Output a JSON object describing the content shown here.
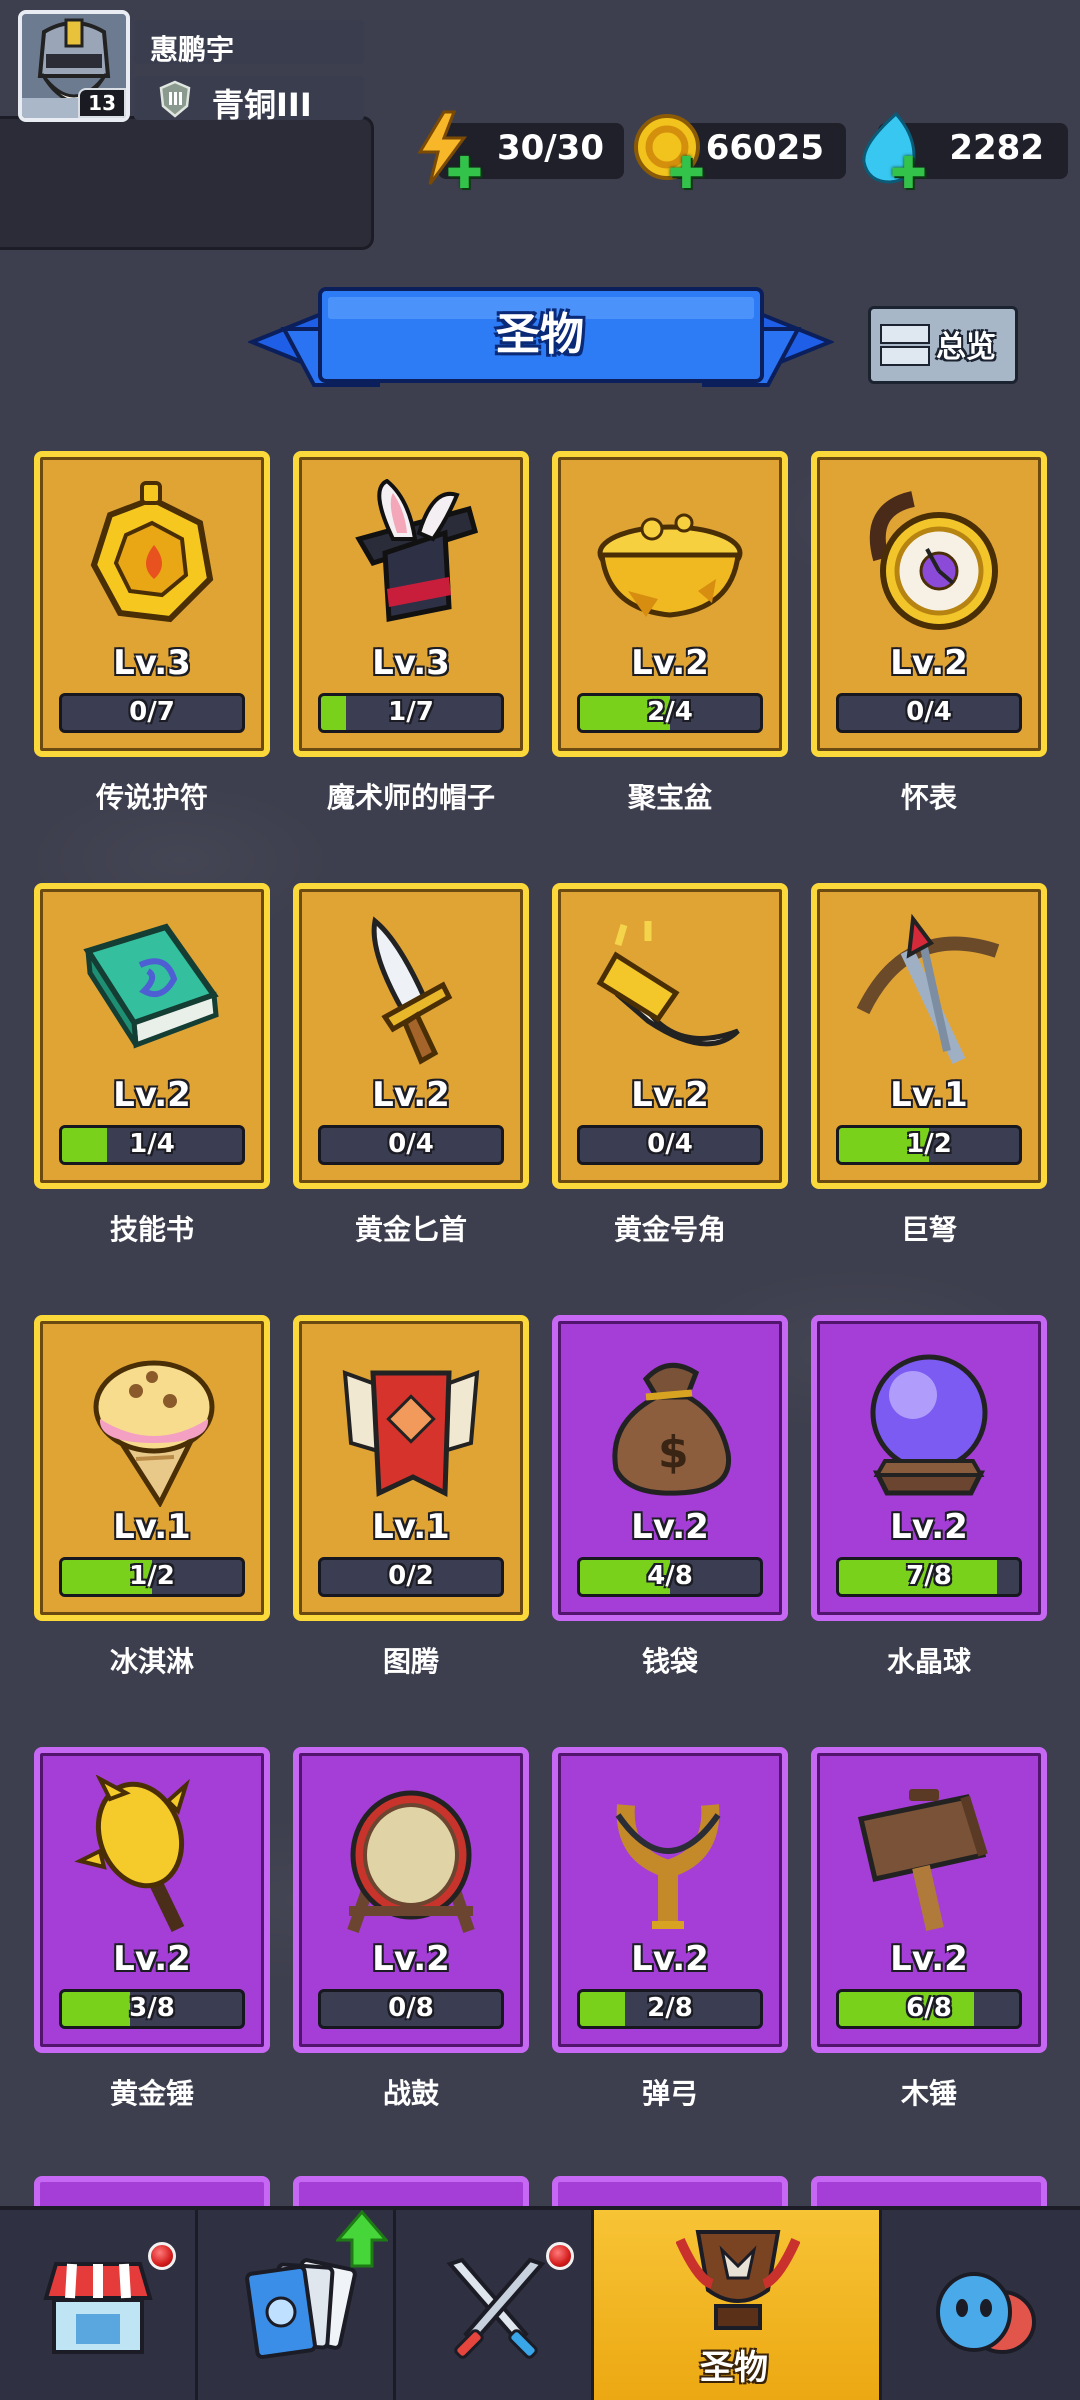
{
  "player": {
    "name": "惠鹏宇",
    "level": "13",
    "rank": "青铜III"
  },
  "currencies": {
    "energy": {
      "icon": "lightning-icon",
      "value": "30/30",
      "color": "#f7b728"
    },
    "gold": {
      "icon": "gold-coin-icon",
      "value": "66025",
      "color": "#f2c21d"
    },
    "gems": {
      "icon": "water-drop-icon",
      "value": "2282",
      "color": "#38c7f0"
    }
  },
  "title": "圣物",
  "overview_label": "总览",
  "items": [
    {
      "name": "传说护符",
      "level": "Lv.3",
      "progress": "0/7",
      "fill": 0,
      "rarity": "gold",
      "icon": "amulet-icon"
    },
    {
      "name": "魔术师的帽子",
      "level": "Lv.3",
      "progress": "1/7",
      "fill": 0.14,
      "rarity": "gold",
      "icon": "magician-hat-icon"
    },
    {
      "name": "聚宝盆",
      "level": "Lv.2",
      "progress": "2/4",
      "fill": 0.5,
      "rarity": "gold",
      "icon": "treasure-bowl-icon"
    },
    {
      "name": "怀表",
      "level": "Lv.2",
      "progress": "0/4",
      "fill": 0,
      "rarity": "gold",
      "icon": "pocket-watch-icon"
    },
    {
      "name": "技能书",
      "level": "Lv.2",
      "progress": "1/4",
      "fill": 0.25,
      "rarity": "gold",
      "icon": "skill-book-icon"
    },
    {
      "name": "黄金匕首",
      "level": "Lv.2",
      "progress": "0/4",
      "fill": 0,
      "rarity": "gold",
      "icon": "dagger-icon"
    },
    {
      "name": "黄金号角",
      "level": "Lv.2",
      "progress": "0/4",
      "fill": 0,
      "rarity": "gold",
      "icon": "horn-icon"
    },
    {
      "name": "巨弩",
      "level": "Lv.1",
      "progress": "1/2",
      "fill": 0.5,
      "rarity": "gold",
      "icon": "crossbow-icon"
    },
    {
      "name": "冰淇淋",
      "level": "Lv.1",
      "progress": "1/2",
      "fill": 0.5,
      "rarity": "gold",
      "icon": "ice-cream-icon"
    },
    {
      "name": "图腾",
      "level": "Lv.1",
      "progress": "0/2",
      "fill": 0,
      "rarity": "gold",
      "icon": "totem-banner-icon"
    },
    {
      "name": "钱袋",
      "level": "Lv.2",
      "progress": "4/8",
      "fill": 0.5,
      "rarity": "purple",
      "icon": "money-bag-icon"
    },
    {
      "name": "水晶球",
      "level": "Lv.2",
      "progress": "7/8",
      "fill": 0.875,
      "rarity": "purple",
      "icon": "crystal-ball-icon"
    },
    {
      "name": "黄金锤",
      "level": "Lv.2",
      "progress": "3/8",
      "fill": 0.375,
      "rarity": "purple",
      "icon": "golden-mace-icon"
    },
    {
      "name": "战鼓",
      "level": "Lv.2",
      "progress": "0/8",
      "fill": 0,
      "rarity": "purple",
      "icon": "war-drum-icon"
    },
    {
      "name": "弹弓",
      "level": "Lv.2",
      "progress": "2/8",
      "fill": 0.25,
      "rarity": "purple",
      "icon": "slingshot-icon"
    },
    {
      "name": "木锤",
      "level": "Lv.2",
      "progress": "6/8",
      "fill": 0.75,
      "rarity": "purple",
      "icon": "wooden-hammer-icon"
    }
  ],
  "nav": [
    {
      "name": "shop",
      "icon": "shop-stall-icon",
      "badge": true
    },
    {
      "name": "cards",
      "icon": "cards-icon",
      "upgrade_arrow": true
    },
    {
      "name": "battle",
      "icon": "crossed-swords-icon",
      "badge": true
    },
    {
      "name": "relics",
      "icon": "relic-trophy-icon",
      "label": "圣物",
      "active": true
    },
    {
      "name": "social",
      "icon": "friends-icon"
    }
  ]
}
